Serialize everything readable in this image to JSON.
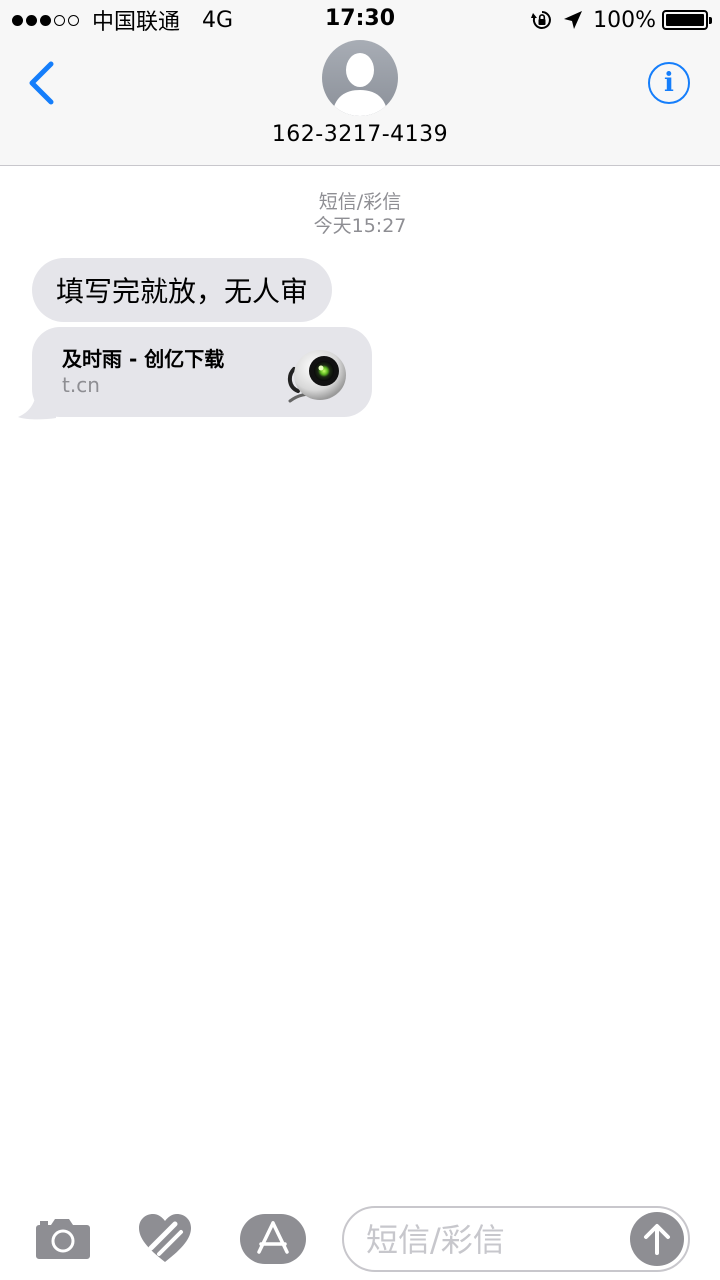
{
  "status_bar": {
    "carrier": "中国联通",
    "network": "4G",
    "time": "17:30",
    "battery": "100%"
  },
  "header": {
    "contact_number": "162-3217-4139",
    "info_label": "i"
  },
  "conversation": {
    "service_label": "短信/彩信",
    "timestamp": "今天15:27",
    "messages": [
      {
        "text": "填写完就放，无人审"
      }
    ],
    "link_preview": {
      "title": "及时雨 - 创亿下载",
      "domain": "t.cn"
    }
  },
  "composer": {
    "placeholder": "短信/彩信"
  },
  "colors": {
    "accent": "#157efb",
    "bubble_gray": "#e5e5ea",
    "meta_gray": "#8e8e93"
  },
  "icons": {
    "back": "chevron-left-icon",
    "camera": "camera-icon",
    "digital_touch": "heart-touch-icon",
    "app_store": "app-store-icon",
    "send": "arrow-up-icon"
  }
}
